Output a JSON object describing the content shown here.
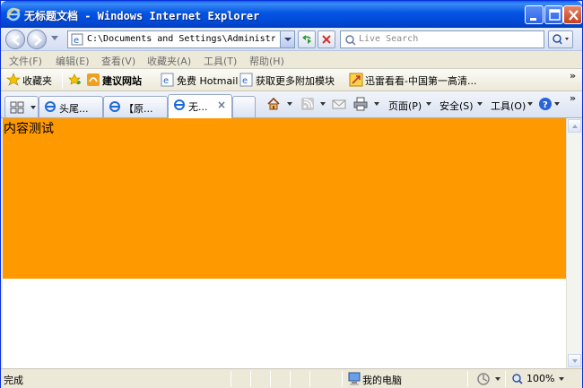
{
  "window": {
    "title": "无标题文档 - Windows Internet Explorer"
  },
  "address": {
    "url": "C:\\Documents and Settings\\Administrator."
  },
  "search": {
    "placeholder": "Live Search"
  },
  "menu": {
    "items": [
      "文件(F)",
      "编辑(E)",
      "查看(V)",
      "收藏夹(A)",
      "工具(T)",
      "帮助(H)"
    ]
  },
  "favorites": {
    "label": "收藏夹",
    "links": [
      "建议网站",
      "免费 Hotmail",
      "获取更多附加模块",
      "迅雷看看-中国第一高清..."
    ]
  },
  "tabs": [
    {
      "label": "头尾..."
    },
    {
      "label": "【原..."
    },
    {
      "label": "无..."
    }
  ],
  "commands": {
    "page": "页面(P)",
    "safety": "安全(S)",
    "tools": "工具(O)"
  },
  "content": {
    "text": "内容测试",
    "block_color": "#ff9900"
  },
  "status": {
    "text": "完成",
    "zone": "我的电脑",
    "zoom": "100%"
  },
  "colors": {
    "titlebar": "#0454e3",
    "chrome": "#ece9d8"
  }
}
